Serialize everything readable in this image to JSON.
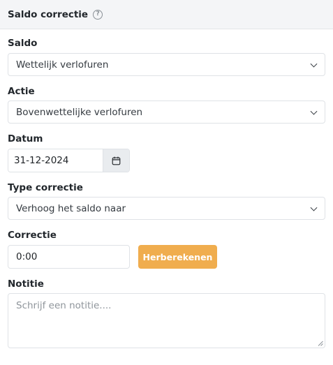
{
  "header": {
    "title": "Saldo correctie",
    "help_icon": "question-circle-icon",
    "help_glyph": "?"
  },
  "form": {
    "saldo": {
      "label": "Saldo",
      "value": "Wettelijk verlofuren"
    },
    "actie": {
      "label": "Actie",
      "value": "Bovenwettelijke verlofuren"
    },
    "datum": {
      "label": "Datum",
      "value": "31-12-2024",
      "icon": "calendar-icon"
    },
    "type_correctie": {
      "label": "Type correctie",
      "value": "Verhoog het saldo naar"
    },
    "correctie": {
      "label": "Correctie",
      "value": "0:00",
      "button_label": "Herberekenen"
    },
    "notitie": {
      "label": "Notitie",
      "placeholder": "Schrijf een notitie...."
    }
  },
  "colors": {
    "accent_button": "#f0ad4e",
    "header_bg": "#f4f5f7",
    "border": "#dfe2e6"
  }
}
